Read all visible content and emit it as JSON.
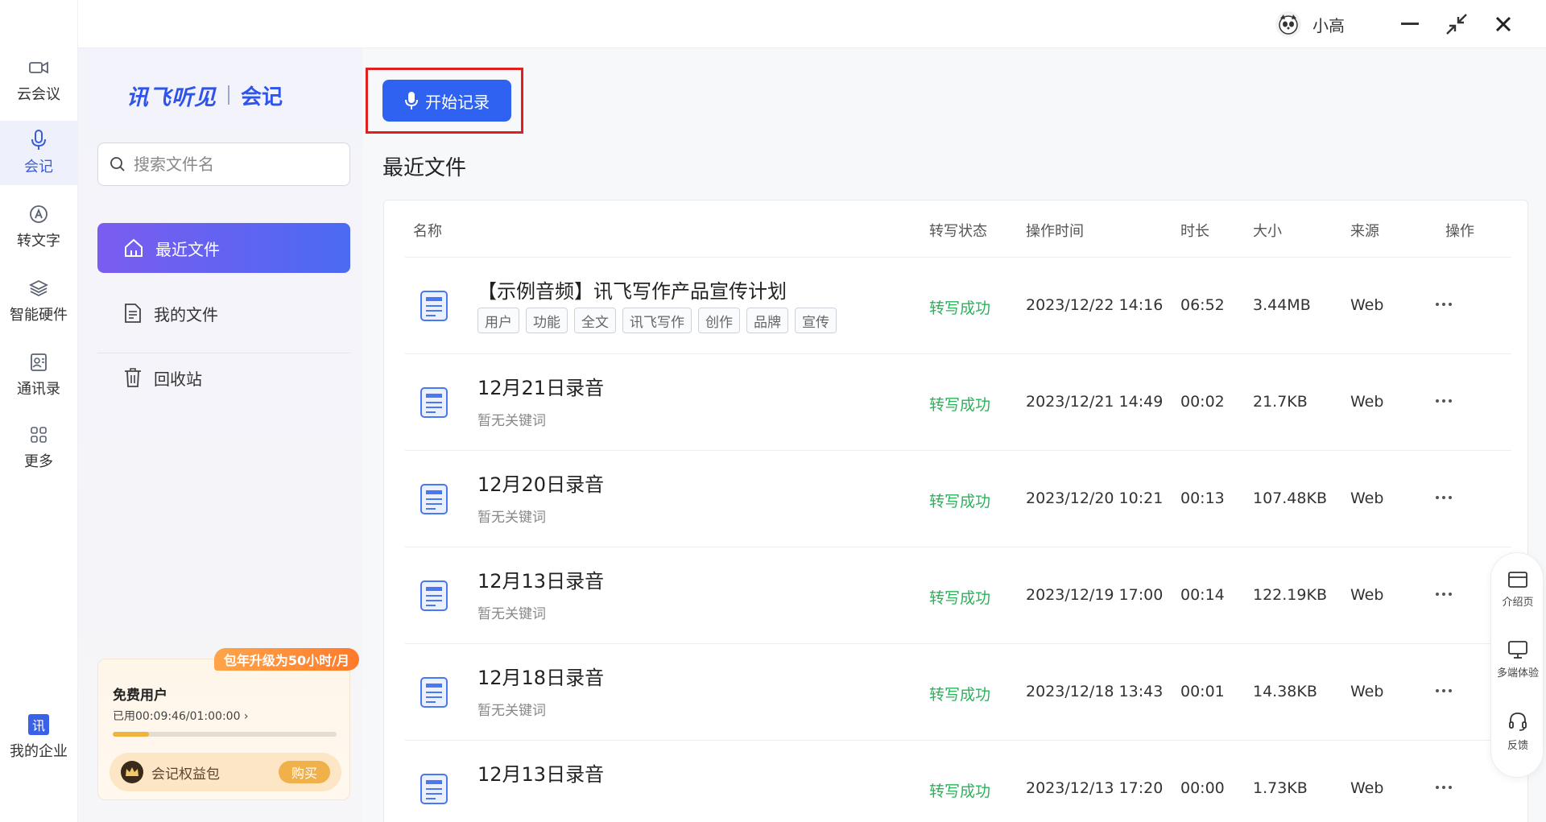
{
  "rail": {
    "items": [
      {
        "label": "云会议",
        "icon": "video-camera-icon"
      },
      {
        "label": "会记",
        "icon": "microphone-icon"
      },
      {
        "label": "转文字",
        "icon": "transcribe-icon"
      },
      {
        "label": "智能硬件",
        "icon": "layers-icon"
      },
      {
        "label": "通讯录",
        "icon": "contacts-icon"
      },
      {
        "label": "更多",
        "icon": "grid-icon"
      }
    ],
    "enterprise": {
      "badge": "讯",
      "label": "我的企业"
    }
  },
  "topbar": {
    "username": "小高"
  },
  "sidebar": {
    "logo_brand": "讯飞听见",
    "logo_product": "会记",
    "search_placeholder": "搜索文件名",
    "nav": [
      {
        "label": "最近文件",
        "icon": "home-icon"
      },
      {
        "label": "我的文件",
        "icon": "file-icon"
      },
      {
        "label": "回收站",
        "icon": "trash-icon"
      }
    ],
    "promo": {
      "badge": "包年升级为50小时/月",
      "title": "免费用户",
      "used": "已用00:09:46/01:00:00",
      "used_fraction": 0.163,
      "pack_label": "会记权益包",
      "buy_label": "购买"
    }
  },
  "main": {
    "record_button": "开始记录",
    "section_title": "最近文件",
    "columns": [
      "名称",
      "转写状态",
      "操作时间",
      "时长",
      "大小",
      "来源",
      "操作"
    ],
    "rows": [
      {
        "name": "【示例音频】讯飞写作产品宣传计划",
        "tags": [
          "用户",
          "功能",
          "全文",
          "讯飞写作",
          "创作",
          "品牌",
          "宣传"
        ],
        "keywords": "",
        "status": "转写成功",
        "time": "2023/12/22 14:16",
        "duration": "06:52",
        "size": "3.44MB",
        "source": "Web"
      },
      {
        "name": "12月21日录音",
        "tags": [],
        "keywords": "暂无关键词",
        "status": "转写成功",
        "time": "2023/12/21 14:49",
        "duration": "00:02",
        "size": "21.7KB",
        "source": "Web"
      },
      {
        "name": "12月20日录音",
        "tags": [],
        "keywords": "暂无关键词",
        "status": "转写成功",
        "time": "2023/12/20 10:21",
        "duration": "00:13",
        "size": "107.48KB",
        "source": "Web"
      },
      {
        "name": "12月13日录音",
        "tags": [],
        "keywords": "暂无关键词",
        "status": "转写成功",
        "time": "2023/12/19 17:00",
        "duration": "00:14",
        "size": "122.19KB",
        "source": "Web"
      },
      {
        "name": "12月18日录音",
        "tags": [],
        "keywords": "暂无关键词",
        "status": "转写成功",
        "time": "2023/12/18 13:43",
        "duration": "00:01",
        "size": "14.38KB",
        "source": "Web"
      },
      {
        "name": "12月13日录音",
        "tags": [],
        "keywords": "",
        "status": "转写成功",
        "time": "2023/12/13 17:20",
        "duration": "00:00",
        "size": "1.73KB",
        "source": "Web"
      }
    ]
  },
  "floating": [
    {
      "label": "介绍页",
      "icon": "browser-icon"
    },
    {
      "label": "多端体验",
      "icon": "monitor-icon"
    },
    {
      "label": "反馈",
      "icon": "headset-icon"
    }
  ],
  "colors": {
    "accent": "#2f62f0",
    "success": "#27b45a",
    "highlight": "#e02020",
    "promo": "#ff7a2a"
  }
}
